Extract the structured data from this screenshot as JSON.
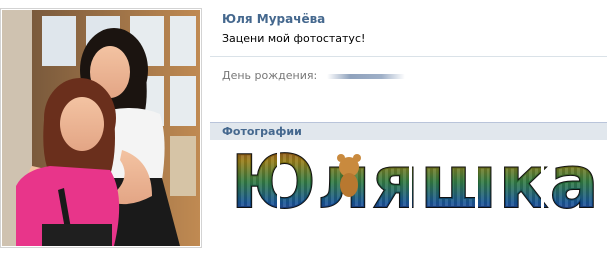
{
  "profile": {
    "name": "Юля Мурачёва",
    "status": "Зацени мой фотостатус!",
    "birthday_label": "День рождения:"
  },
  "photos": {
    "header": "Фотографии",
    "banner_text": "Юляшка"
  },
  "colors": {
    "link_blue": "#45688e",
    "header_bg": "#e1e7ed",
    "header_border": "#b9c4da",
    "label_gray": "#777777"
  }
}
